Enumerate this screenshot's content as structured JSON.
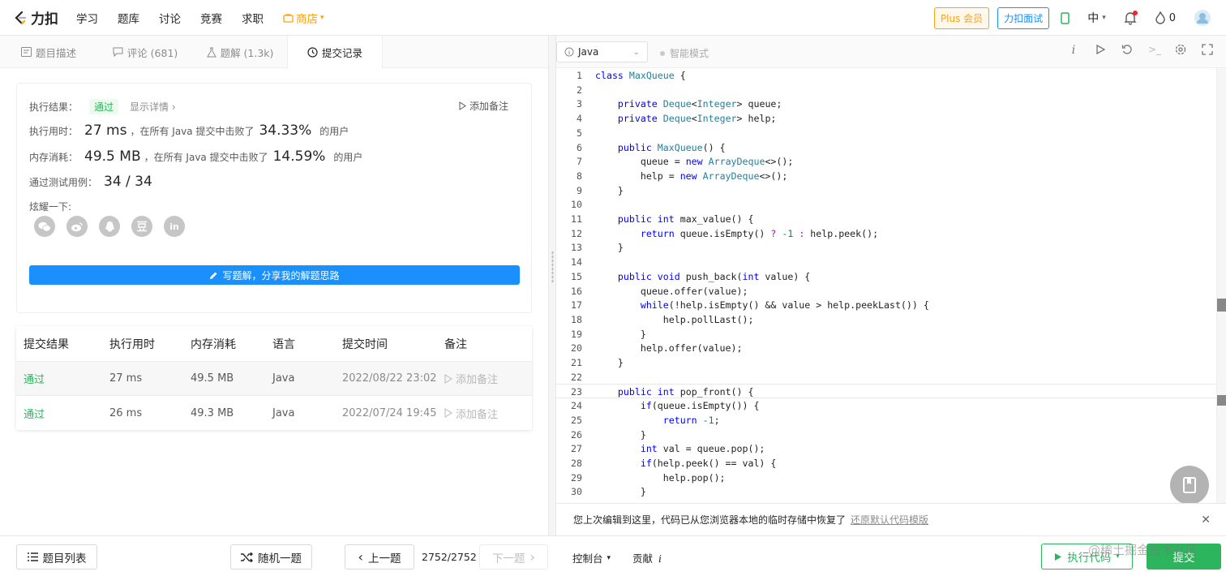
{
  "nav": {
    "logo_text": "力扣",
    "items": [
      "学习",
      "题库",
      "讨论",
      "竞赛",
      "求职"
    ],
    "store_label": "商店",
    "plus_label": "Plus 会员",
    "interview_label": "力扣面试",
    "lang_label": "中",
    "coins": "0"
  },
  "left_tabs": [
    {
      "label": "题目描述",
      "icon": "description-icon"
    },
    {
      "label": "评论 (681)",
      "icon": "comment-icon"
    },
    {
      "label": "题解 (1.3k)",
      "icon": "flask-icon"
    },
    {
      "label": "提交记录",
      "icon": "clock-icon"
    }
  ],
  "result": {
    "status_label": "执行结果：",
    "status": "通过",
    "detail_link": "显示详情 ›",
    "add_note": "添加备注",
    "runtime_label": "执行用时：",
    "runtime": "27 ms",
    "runtime_text": "，在所有 Java 提交中击败了",
    "runtime_pct": "34.33%",
    "users_text": "的用户",
    "memory_label": "内存消耗：",
    "memory": "49.5 MB",
    "memory_text": "，在所有 Java 提交中击败了",
    "memory_pct": "14.59%",
    "tests_label": "通过测试用例：",
    "tests": "34 / 34",
    "share_label": "炫耀一下:",
    "share_icons": [
      "wechat-icon",
      "weibo-icon",
      "qq-icon",
      "douban-icon",
      "linkedin-icon"
    ],
    "write_solution": "写题解，分享我的解题思路"
  },
  "submissions": {
    "headers": [
      "提交结果",
      "执行用时",
      "内存消耗",
      "语言",
      "提交时间",
      "备注"
    ],
    "rows": [
      {
        "status": "通过",
        "runtime": "27 ms",
        "memory": "49.5 MB",
        "lang": "Java",
        "time": "2022/08/22 23:02",
        "note": "添加备注"
      },
      {
        "status": "通过",
        "runtime": "26 ms",
        "memory": "49.3 MB",
        "lang": "Java",
        "time": "2022/07/24 19:45",
        "note": "添加备注"
      }
    ]
  },
  "bottom": {
    "problem_list": "题目列表",
    "random": "随机一题",
    "prev": "上一题",
    "counter": "2752/2752",
    "next": "下一题",
    "console": "控制台",
    "contribute": "贡献",
    "run": "执行代码",
    "submit": "提交",
    "watermark": "@稀土掘金技术社区"
  },
  "editor": {
    "language": "Java",
    "smart_mode": "智能模式",
    "restore_text": "您上次编辑到这里，代码已从您浏览器本地的临时存储中恢复了",
    "restore_link": "还原默认代码模版",
    "lines": [
      "class MaxQueue {",
      "",
      "    private Deque<Integer> queue;",
      "    private Deque<Integer> help;",
      "",
      "    public MaxQueue() {",
      "        queue = new ArrayDeque<>();",
      "        help = new ArrayDeque<>();",
      "    }",
      "",
      "    public int max_value() {",
      "        return queue.isEmpty() ? -1 : help.peek();",
      "    }",
      "",
      "    public void push_back(int value) {",
      "        queue.offer(value);",
      "        while(!help.isEmpty() && value > help.peekLast()) {",
      "            help.pollLast();",
      "        }",
      "        help.offer(value);",
      "    }",
      "",
      "    public int pop_front() {",
      "        if(queue.isEmpty()) {",
      "            return -1;",
      "        }",
      "        int val = queue.pop();",
      "        if(help.peek() == val) {",
      "            help.pop();",
      "        }"
    ]
  }
}
